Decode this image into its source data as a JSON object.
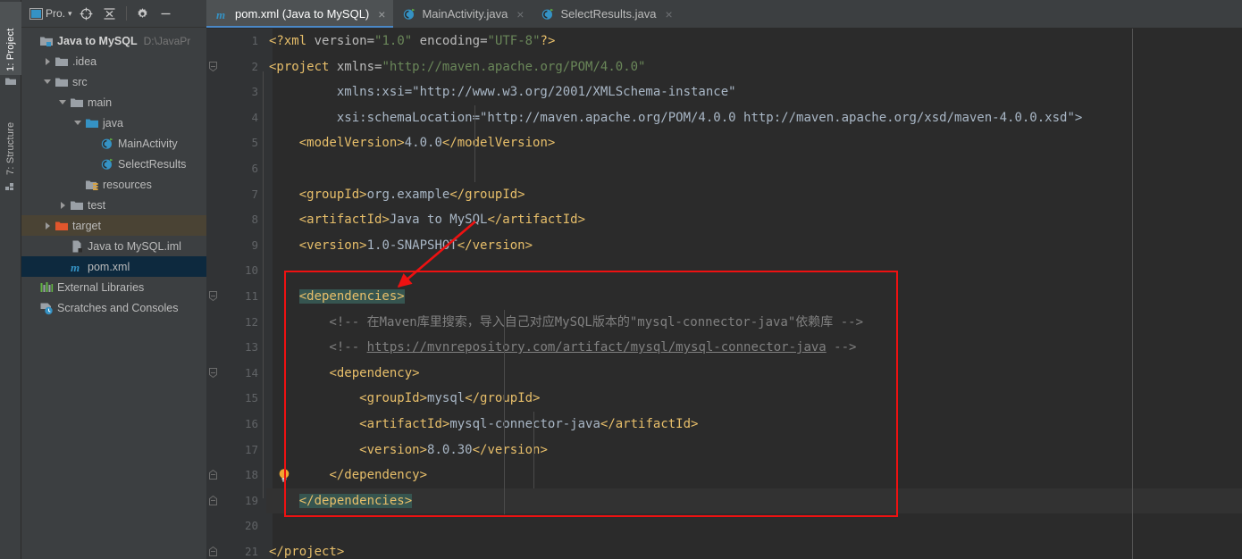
{
  "toolstrip": {
    "tabs": [
      {
        "label": "1: Project",
        "icon": "folder-icon",
        "active": true
      },
      {
        "label": "7: Structure",
        "icon": "structure-icon",
        "active": false
      }
    ]
  },
  "project_panel": {
    "toolbar": {
      "view_label": "Pro.",
      "view_chevron": "▾",
      "buttons": [
        {
          "name": "select-opened-file-button",
          "icon": "crosshair-icon"
        },
        {
          "name": "collapse-all-button",
          "icon": "collapse-all-icon"
        },
        {
          "name": "settings-button",
          "icon": "gear-icon"
        },
        {
          "name": "hide-button",
          "icon": "minimize-icon"
        }
      ]
    },
    "tree": [
      {
        "label": "Java to MySQL",
        "path": "D:\\JavaPr",
        "icon": "project-folder-icon",
        "indent": 0,
        "twist": "none",
        "bold": true,
        "selected": "none"
      },
      {
        "label": ".idea",
        "icon": "folder-icon",
        "indent": 1,
        "twist": "right",
        "bold": false,
        "selected": "none"
      },
      {
        "label": "src",
        "icon": "folder-icon",
        "indent": 1,
        "twist": "down",
        "bold": false,
        "selected": "none"
      },
      {
        "label": "main",
        "icon": "folder-icon",
        "indent": 2,
        "twist": "down",
        "bold": false,
        "selected": "none"
      },
      {
        "label": "java",
        "icon": "source-folder-icon",
        "indent": 3,
        "twist": "down",
        "bold": false,
        "selected": "none"
      },
      {
        "label": "MainActivity",
        "icon": "java-class-icon",
        "indent": 4,
        "twist": "none",
        "bold": false,
        "selected": "none"
      },
      {
        "label": "SelectResults",
        "icon": "java-class-icon",
        "indent": 4,
        "twist": "none",
        "bold": false,
        "selected": "none"
      },
      {
        "label": "resources",
        "icon": "resources-folder-icon",
        "indent": 3,
        "twist": "none",
        "bold": false,
        "selected": "none"
      },
      {
        "label": "test",
        "icon": "folder-icon",
        "indent": 2,
        "twist": "right",
        "bold": false,
        "selected": "none"
      },
      {
        "label": "target",
        "icon": "target-folder-icon",
        "indent": 1,
        "twist": "right",
        "bold": false,
        "selected": "brown"
      },
      {
        "label": "Java to MySQL.iml",
        "icon": "iml-file-icon",
        "indent": 2,
        "twist": "none",
        "bold": false,
        "selected": "none"
      },
      {
        "label": "pom.xml",
        "icon": "maven-icon",
        "indent": 2,
        "twist": "none",
        "bold": false,
        "selected": "blue"
      },
      {
        "label": "External Libraries",
        "icon": "libraries-icon",
        "indent": 0,
        "twist": "none",
        "bold": false,
        "selected": "none"
      },
      {
        "label": "Scratches and Consoles",
        "icon": "scratches-icon",
        "indent": 0,
        "twist": "none",
        "bold": false,
        "selected": "none"
      }
    ]
  },
  "editor": {
    "tabs": [
      {
        "label": "pom.xml (Java to MySQL)",
        "icon": "maven-icon",
        "active": true,
        "close": "×"
      },
      {
        "label": "MainActivity.java",
        "icon": "java-class-icon",
        "active": false,
        "close": "×"
      },
      {
        "label": "SelectResults.java",
        "icon": "java-class-icon",
        "active": false,
        "close": "×"
      }
    ],
    "line_numbers": [
      "1",
      "2",
      "3",
      "4",
      "5",
      "6",
      "7",
      "8",
      "9",
      "10",
      "11",
      "12",
      "13",
      "14",
      "15",
      "16",
      "17",
      "18",
      "19",
      "20",
      "21"
    ],
    "lines": [
      {
        "n": 1,
        "indent": 0,
        "text": "<?xml version=\"1.0\" encoding=\"UTF-8\"?>"
      },
      {
        "n": 2,
        "indent": 0,
        "text": "<project xmlns=\"http://maven.apache.org/POM/4.0.0\""
      },
      {
        "n": 3,
        "indent": 0,
        "text": "         xmlns:xsi=\"http://www.w3.org/2001/XMLSchema-instance\""
      },
      {
        "n": 4,
        "indent": 0,
        "text": "         xsi:schemaLocation=\"http://maven.apache.org/POM/4.0.0 http://maven.apache.org/xsd/maven-4.0.0.xsd\">"
      },
      {
        "n": 5,
        "indent": 0,
        "text": "    <modelVersion>4.0.0</modelVersion>"
      },
      {
        "n": 6,
        "indent": 0,
        "text": ""
      },
      {
        "n": 7,
        "indent": 0,
        "text": "    <groupId>org.example</groupId>"
      },
      {
        "n": 8,
        "indent": 0,
        "text": "    <artifactId>Java to MySQL</artifactId>"
      },
      {
        "n": 9,
        "indent": 0,
        "text": "    <version>1.0-SNAPSHOT</version>"
      },
      {
        "n": 10,
        "indent": 0,
        "text": ""
      },
      {
        "n": 11,
        "indent": 0,
        "text": "    <dependencies>"
      },
      {
        "n": 12,
        "indent": 0,
        "text": "        <!-- 在Maven库里搜索，导入自己对应MySQL版本的\"mysql-connector-java\"依赖库 -->"
      },
      {
        "n": 13,
        "indent": 0,
        "text": "        <!-- https://mvnrepository.com/artifact/mysql/mysql-connector-java -->"
      },
      {
        "n": 14,
        "indent": 0,
        "text": "        <dependency>"
      },
      {
        "n": 15,
        "indent": 0,
        "text": "            <groupId>mysql</groupId>"
      },
      {
        "n": 16,
        "indent": 0,
        "text": "            <artifactId>mysql-connector-java</artifactId>"
      },
      {
        "n": 17,
        "indent": 0,
        "text": "            <version>8.0.30</version>"
      },
      {
        "n": 18,
        "indent": 0,
        "text": "        </dependency>"
      },
      {
        "n": 19,
        "indent": 0,
        "text": "    </dependencies>"
      },
      {
        "n": 20,
        "indent": 0,
        "text": ""
      },
      {
        "n": 21,
        "indent": 0,
        "text": "</project>"
      }
    ],
    "caret_line": 19,
    "highlighted_tokens": [
      "<dependencies>",
      "</dependencies>"
    ],
    "bulb_line": 18,
    "fold_lines": [
      2,
      11,
      14,
      18,
      19,
      21
    ],
    "comment_link": "https://mvnrepository.com/artifact/mysql/mysql-connector-java"
  },
  "annotation": {
    "box_color": "#ee1111",
    "arrow_color": "#ee1111",
    "boxed_lines": "11-19",
    "arrow_points_to": "<dependencies>"
  },
  "colors": {
    "background": "#2b2b2b",
    "panel": "#3c3f41",
    "gutter": "#313335",
    "tag": "#e8bf6a",
    "attribute": "#bababa",
    "namespace": "#9876aa",
    "value": "#6a8759",
    "text": "#a9b7c6",
    "comment": "#808080",
    "selection_highlight": "#365550",
    "tab_underline": "#4a88c7",
    "tree_selection": "#0d293e"
  }
}
